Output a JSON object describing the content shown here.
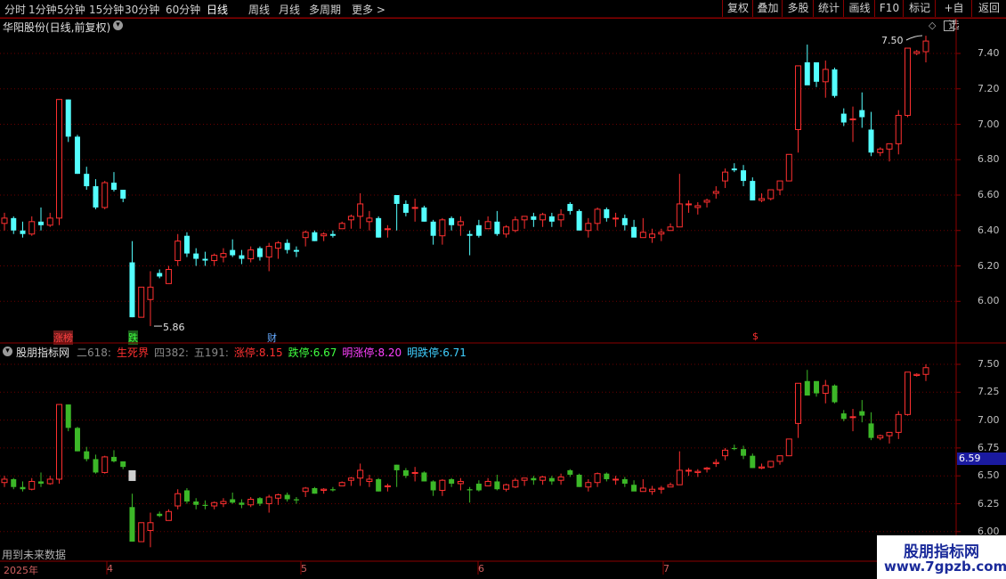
{
  "toolbar": {
    "periods": [
      "分时",
      "1分钟",
      "5分钟",
      "15分钟",
      "30分钟",
      "60分钟",
      "日线",
      "周线",
      "月线",
      "多周期",
      "更多 >"
    ],
    "active_period": "日线",
    "right_buttons": [
      "复权",
      "叠加",
      "多股",
      "统计",
      "画线",
      "F10",
      "标记",
      "+自选",
      "返回"
    ]
  },
  "main_panel": {
    "title": "华阳股份(日线,前复权)",
    "price_labels": [
      "7.40",
      "7.20",
      "7.00",
      "6.80",
      "6.60",
      "6.40",
      "6.20",
      "6.00"
    ],
    "high_annotation": "7.50",
    "low_annotation": "5.86",
    "event_tags": [
      {
        "text": "涨榜",
        "color": "#ff4040"
      },
      {
        "text": "跌",
        "color": "#40ff40"
      },
      {
        "text": "财",
        "color": "#66aaff"
      },
      {
        "text": "$",
        "color": "#ff3030"
      }
    ]
  },
  "indicator_panel": {
    "title": "股朋指标网",
    "values": [
      {
        "label": "二618:",
        "value": "",
        "color": "#888888"
      },
      {
        "label": "生死界",
        "value": "",
        "color": "#ff3030"
      },
      {
        "label": "四382:",
        "value": "",
        "color": "#888888"
      },
      {
        "label": "五191:",
        "value": "",
        "color": "#888888"
      },
      {
        "label": "涨停:",
        "value": "8.15",
        "color": "#ff3030"
      },
      {
        "label": "跌停:",
        "value": "6.67",
        "color": "#40ff40"
      },
      {
        "label": "明涨停:",
        "value": "8.20",
        "color": "#ff40ff"
      },
      {
        "label": "明跌停:",
        "value": "6.71",
        "color": "#40d0ff"
      }
    ],
    "price_labels": [
      "7.50",
      "7.25",
      "7.00",
      "6.75",
      "6.50",
      "6.25",
      "6.00"
    ],
    "current_value": "6.59",
    "footnote": "用到未来数据"
  },
  "date_axis": {
    "labels": [
      "2025年",
      "4",
      "5",
      "6",
      "7"
    ]
  },
  "watermark": {
    "line1": "股朋指标网",
    "line2": "www.7gpzb.com"
  },
  "colors": {
    "up": "#ff3030",
    "down": "#54ffff",
    "ind_up": "#ff3030",
    "ind_down": "#3cb828",
    "background": "#000000",
    "grid": "#6a0000"
  },
  "chart_data": {
    "type": "candlestick",
    "candles": [
      [
        6.44,
        6.5,
        6.4,
        6.47
      ],
      [
        6.47,
        6.48,
        6.38,
        6.4
      ],
      [
        6.4,
        6.45,
        6.36,
        6.38
      ],
      [
        6.38,
        6.48,
        6.37,
        6.45
      ],
      [
        6.45,
        6.53,
        6.4,
        6.43
      ],
      [
        6.43,
        6.5,
        6.42,
        6.47
      ],
      [
        6.47,
        7.14,
        6.43,
        7.14
      ],
      [
        7.14,
        7.14,
        6.9,
        6.93
      ],
      [
        6.93,
        6.94,
        6.72,
        6.72
      ],
      [
        6.72,
        6.76,
        6.63,
        6.65
      ],
      [
        6.65,
        6.69,
        6.52,
        6.53
      ],
      [
        6.53,
        6.68,
        6.52,
        6.67
      ],
      [
        6.67,
        6.73,
        6.62,
        6.63
      ],
      [
        6.63,
        6.63,
        6.56,
        6.58
      ],
      [
        6.22,
        6.34,
        5.91,
        5.91
      ],
      [
        5.91,
        6.08,
        5.91,
        6.08
      ],
      [
        6.01,
        6.17,
        5.86,
        6.08
      ],
      [
        6.16,
        6.18,
        6.13,
        6.14
      ],
      [
        6.1,
        6.2,
        6.1,
        6.18
      ],
      [
        6.23,
        6.38,
        6.2,
        6.34
      ],
      [
        6.37,
        6.39,
        6.25,
        6.27
      ],
      [
        6.27,
        6.3,
        6.2,
        6.24
      ],
      [
        6.24,
        6.28,
        6.2,
        6.23
      ],
      [
        6.23,
        6.27,
        6.2,
        6.26
      ],
      [
        6.25,
        6.3,
        6.22,
        6.27
      ],
      [
        6.29,
        6.35,
        6.25,
        6.26
      ],
      [
        6.26,
        6.29,
        6.21,
        6.24
      ],
      [
        6.24,
        6.31,
        6.22,
        6.29
      ],
      [
        6.3,
        6.31,
        6.23,
        6.25
      ],
      [
        6.25,
        6.33,
        6.17,
        6.31
      ],
      [
        6.3,
        6.34,
        6.24,
        6.33
      ],
      [
        6.33,
        6.35,
        6.27,
        6.29
      ],
      [
        6.29,
        6.31,
        6.25,
        6.28
      ],
      [
        6.36,
        6.4,
        6.31,
        6.39
      ],
      [
        6.39,
        6.4,
        6.34,
        6.34
      ],
      [
        6.37,
        6.39,
        6.34,
        6.38
      ],
      [
        6.38,
        6.4,
        6.36,
        6.37
      ],
      [
        6.41,
        6.45,
        6.41,
        6.44
      ],
      [
        6.46,
        6.49,
        6.41,
        6.48
      ],
      [
        6.48,
        6.61,
        6.41,
        6.55
      ],
      [
        6.45,
        6.51,
        6.4,
        6.47
      ],
      [
        6.47,
        6.48,
        6.36,
        6.36
      ],
      [
        6.41,
        6.43,
        6.36,
        6.41
      ],
      [
        6.6,
        6.6,
        6.4,
        6.55
      ],
      [
        6.55,
        6.57,
        6.48,
        6.5
      ],
      [
        6.53,
        6.58,
        6.45,
        6.53
      ],
      [
        6.53,
        6.54,
        6.45,
        6.45
      ],
      [
        6.45,
        6.46,
        6.32,
        6.37
      ],
      [
        6.37,
        6.47,
        6.32,
        6.46
      ],
      [
        6.47,
        6.48,
        6.4,
        6.43
      ],
      [
        6.43,
        6.48,
        6.37,
        6.45
      ],
      [
        6.38,
        6.4,
        6.26,
        6.37
      ],
      [
        6.43,
        6.46,
        6.36,
        6.37
      ],
      [
        6.41,
        6.48,
        6.41,
        6.45
      ],
      [
        6.45,
        6.51,
        6.37,
        6.38
      ],
      [
        6.38,
        6.43,
        6.36,
        6.42
      ],
      [
        6.4,
        6.48,
        6.39,
        6.46
      ],
      [
        6.46,
        6.48,
        6.41,
        6.48
      ],
      [
        6.48,
        6.5,
        6.42,
        6.46
      ],
      [
        6.46,
        6.5,
        6.42,
        6.49
      ],
      [
        6.48,
        6.5,
        6.42,
        6.45
      ],
      [
        6.46,
        6.52,
        6.42,
        6.49
      ],
      [
        6.55,
        6.56,
        6.49,
        6.51
      ],
      [
        6.51,
        6.52,
        6.4,
        6.4
      ],
      [
        6.4,
        6.47,
        6.36,
        6.44
      ],
      [
        6.44,
        6.53,
        6.4,
        6.52
      ],
      [
        6.52,
        6.53,
        6.45,
        6.47
      ],
      [
        6.47,
        6.5,
        6.42,
        6.47
      ],
      [
        6.47,
        6.49,
        6.4,
        6.43
      ],
      [
        6.42,
        6.46,
        6.4,
        6.36
      ],
      [
        6.36,
        6.47,
        6.36,
        6.39
      ],
      [
        6.36,
        6.41,
        6.33,
        6.38
      ],
      [
        6.38,
        6.41,
        6.34,
        6.39
      ],
      [
        6.4,
        6.44,
        6.4,
        6.42
      ],
      [
        6.42,
        6.72,
        6.42,
        6.55
      ],
      [
        6.55,
        6.57,
        6.5,
        6.55
      ],
      [
        6.53,
        6.56,
        6.49,
        6.54
      ],
      [
        6.56,
        6.58,
        6.53,
        6.57
      ],
      [
        6.61,
        6.65,
        6.58,
        6.62
      ],
      [
        6.68,
        6.75,
        6.64,
        6.73
      ],
      [
        6.75,
        6.78,
        6.73,
        6.74
      ],
      [
        6.74,
        6.77,
        6.65,
        6.68
      ],
      [
        6.68,
        6.7,
        6.57,
        6.57
      ],
      [
        6.57,
        6.61,
        6.56,
        6.58
      ],
      [
        6.58,
        6.62,
        6.57,
        6.63
      ],
      [
        6.63,
        6.68,
        6.6,
        6.68
      ],
      [
        6.68,
        6.82,
        6.68,
        6.83
      ],
      [
        6.97,
        7.33,
        6.84,
        7.33
      ],
      [
        7.35,
        7.45,
        7.26,
        7.22
      ],
      [
        7.35,
        7.3,
        7.21,
        7.24
      ],
      [
        7.24,
        7.36,
        7.15,
        7.31
      ],
      [
        7.31,
        7.32,
        7.15,
        7.16
      ],
      [
        7.06,
        7.09,
        6.99,
        7.01
      ],
      [
        7.03,
        7.1,
        6.9,
        7.03
      ],
      [
        7.08,
        7.18,
        6.98,
        7.04
      ],
      [
        6.97,
        7.07,
        6.82,
        6.84
      ],
      [
        6.84,
        6.87,
        6.82,
        6.86
      ],
      [
        6.86,
        6.88,
        6.79,
        6.89
      ],
      [
        6.89,
        7.08,
        6.83,
        7.05
      ],
      [
        7.05,
        7.43,
        7.04,
        7.43
      ],
      [
        7.4,
        7.42,
        7.39,
        7.41
      ],
      [
        7.41,
        7.5,
        7.35,
        7.47
      ]
    ],
    "ylim": [
      5.8,
      7.5
    ],
    "ylabel": "",
    "xlabel": ""
  }
}
